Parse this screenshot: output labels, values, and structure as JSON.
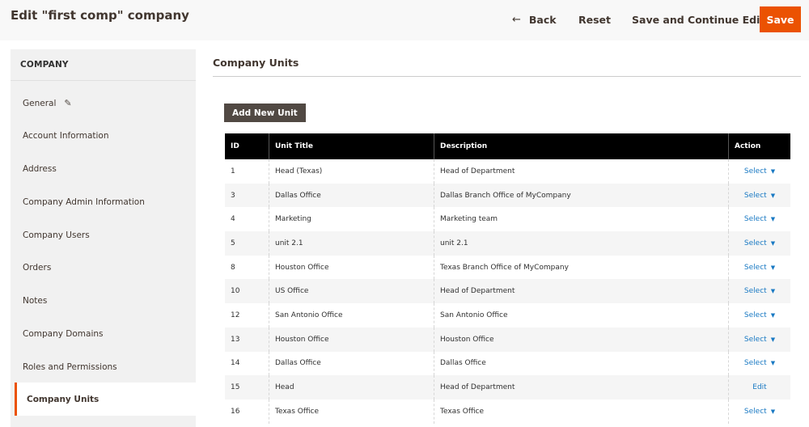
{
  "header": {
    "title": "Edit \"first comp\" company",
    "back_label": "Back",
    "reset_label": "Reset",
    "save_continue_label": "Save and Continue Edit",
    "save_label": "Save"
  },
  "sidebar": {
    "title": "COMPANY",
    "items": [
      {
        "label": "General",
        "icon": "pencil-icon"
      },
      {
        "label": "Account Information"
      },
      {
        "label": "Address"
      },
      {
        "label": "Company Admin Information"
      },
      {
        "label": "Company Users"
      },
      {
        "label": "Orders"
      },
      {
        "label": "Notes"
      },
      {
        "label": "Company Domains"
      },
      {
        "label": "Roles and Permissions"
      },
      {
        "label": "Company Units",
        "active": true
      }
    ]
  },
  "main": {
    "section_title": "Company Units",
    "add_button_label": "Add New Unit",
    "table": {
      "headers": [
        "ID",
        "Unit Title",
        "Description",
        "Action"
      ],
      "rows": [
        {
          "id": "1",
          "title": "Head (Texas)",
          "description": "Head of Department",
          "action": "Select"
        },
        {
          "id": "3",
          "title": "Dallas Office",
          "description": "Dallas Branch Office of MyCompany",
          "action": "Select"
        },
        {
          "id": "4",
          "title": "Marketing",
          "description": "Marketing team",
          "action": "Select"
        },
        {
          "id": "5",
          "title": "unit 2.1",
          "description": "unit 2.1",
          "action": "Select"
        },
        {
          "id": "8",
          "title": "Houston Office",
          "description": "Texas Branch Office of MyCompany",
          "action": "Select"
        },
        {
          "id": "10",
          "title": "US Office",
          "description": "Head of Department",
          "action": "Select"
        },
        {
          "id": "12",
          "title": "San Antonio Office",
          "description": "San Antonio Office",
          "action": "Select"
        },
        {
          "id": "13",
          "title": "Houston Office",
          "description": "Houston Office",
          "action": "Select"
        },
        {
          "id": "14",
          "title": "Dallas Office",
          "description": "Dallas Office",
          "action": "Select"
        },
        {
          "id": "15",
          "title": "Head",
          "description": "Head of Department",
          "action": "Edit"
        },
        {
          "id": "16",
          "title": "Texas Office",
          "description": "Texas Office",
          "action": "Select"
        }
      ]
    }
  },
  "colors": {
    "accent": "#eb5202",
    "link": "#1979c3",
    "table_header": "#000000",
    "secondary_button": "#514943"
  }
}
